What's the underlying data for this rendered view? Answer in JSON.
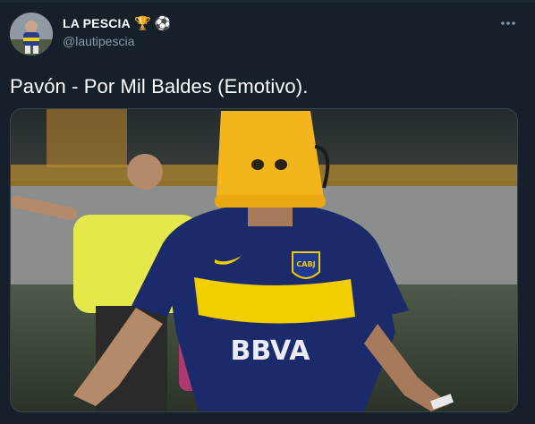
{
  "author": {
    "display_name": "LA PESCIA",
    "badge_emojis": [
      "🏆",
      "⚽"
    ],
    "handle": "@lautipescia"
  },
  "tweet": {
    "text": "Pavón - Por Mil Baldes (Emotivo)."
  },
  "media": {
    "description_icon": "photo",
    "jersey_sponsor": "BBVA",
    "crest_text": "CABJ"
  },
  "icons": {
    "more": "more-horizontal-icon"
  },
  "colors": {
    "background": "#15202b",
    "secondary_text": "#8899a6",
    "jersey_navy": "#1b2a6b",
    "jersey_yellow": "#f2cd00",
    "bucket": "#f2b51c"
  }
}
